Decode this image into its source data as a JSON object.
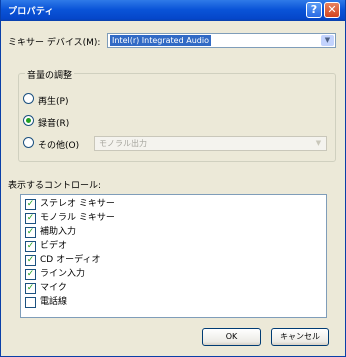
{
  "window": {
    "title": "プロパティ"
  },
  "mixer": {
    "label": "ミキサー デバイス(M):",
    "device": "Intel(r) Integrated Audio"
  },
  "volume_group": {
    "legend": "音量の調整",
    "options": [
      {
        "label": "再生(P)",
        "selected": false
      },
      {
        "label": "録音(R)",
        "selected": true
      },
      {
        "label": "その他(O)",
        "selected": false
      }
    ],
    "other_combo": "モノラル出力"
  },
  "controls": {
    "label": "表示するコントロール:",
    "items": [
      {
        "label": "ステレオ ミキサー",
        "checked": true
      },
      {
        "label": "モノラル ミキサー",
        "checked": true
      },
      {
        "label": "補助入力",
        "checked": true
      },
      {
        "label": "ビデオ",
        "checked": true
      },
      {
        "label": "CD オーディオ",
        "checked": true
      },
      {
        "label": "ライン入力",
        "checked": true
      },
      {
        "label": "マイク",
        "checked": true
      },
      {
        "label": "電話線",
        "checked": false
      }
    ]
  },
  "buttons": {
    "ok": "OK",
    "cancel": "キャンセル"
  }
}
